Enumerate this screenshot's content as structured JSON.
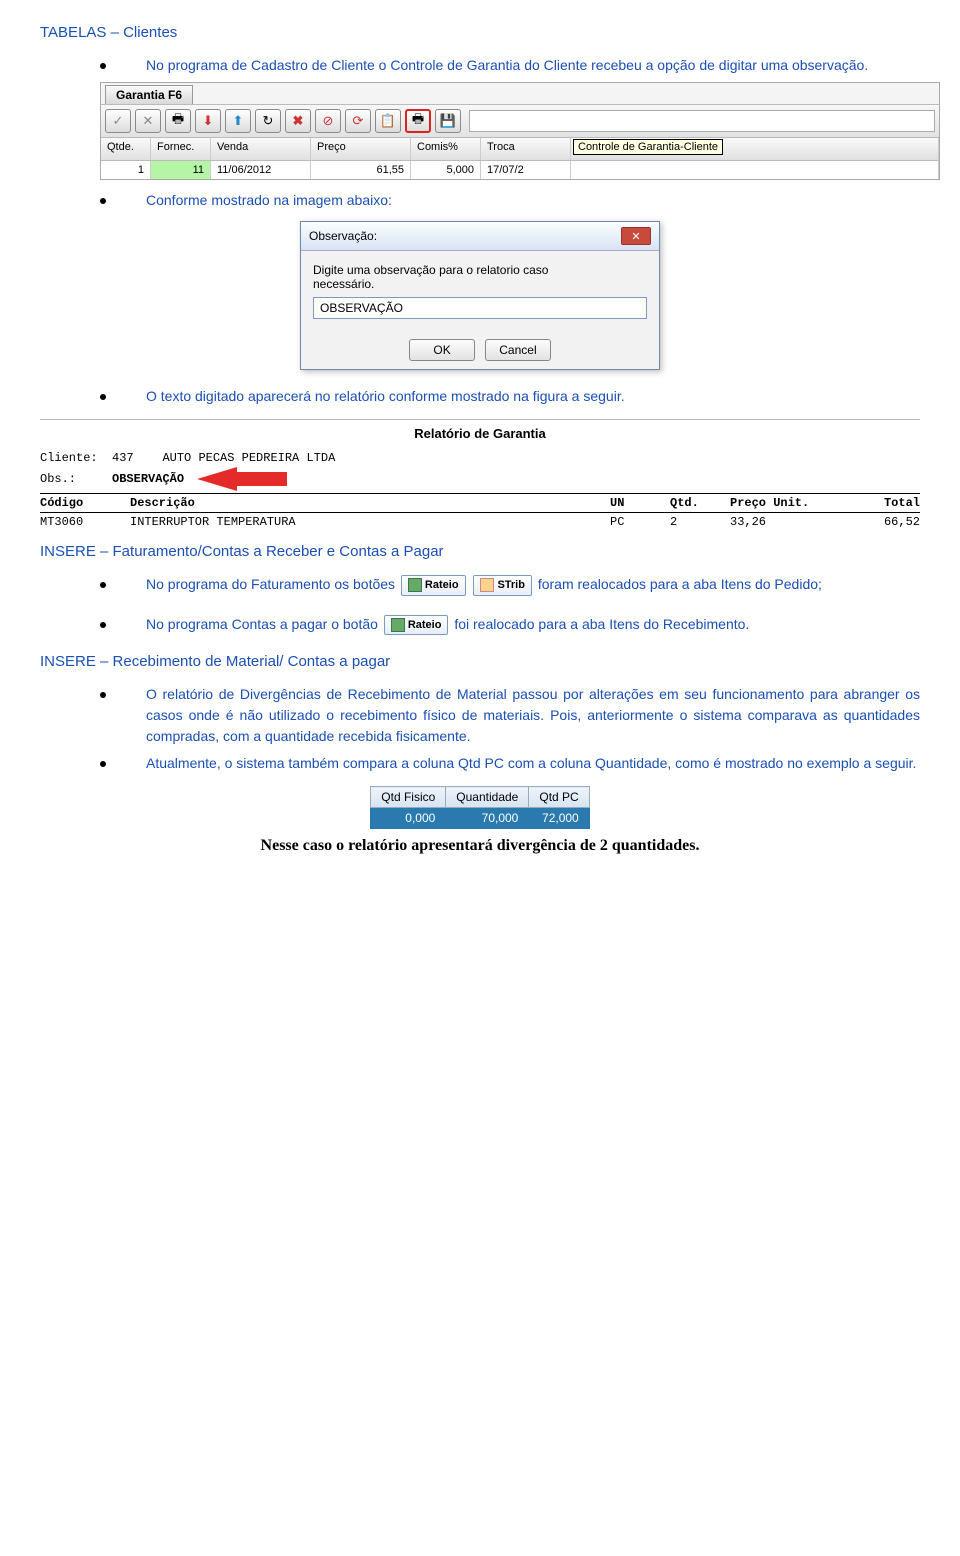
{
  "doc": {
    "h1": "TABELAS – Clientes",
    "b1": "No programa de Cadastro de Cliente o Controle de Garantia do Cliente recebeu a opção de digitar uma observação.",
    "b2": "Conforme mostrado na imagem abaixo:",
    "b3": "O texto digitado aparecerá no relatório conforme mostrado na figura a seguir.",
    "h2": "INSERE – Faturamento/Contas a Receber e Contas a Pagar",
    "b4a": "No programa do Faturamento os botões ",
    "b4b": " foram realocados para a aba Itens do Pedido;",
    "b5a": "No programa Contas a pagar o botão ",
    "b5b": " foi realocado para a aba Itens do Recebimento.",
    "h3": "INSERE – Recebimento de Material/ Contas a pagar",
    "b6": "O relatório de Divergências de Recebimento de Material passou por alterações em seu funcionamento para abranger os casos onde é não utilizado o recebimento físico de materiais. Pois, anteriormente o sistema comparava as quantidades compradas, com a quantidade recebida fisicamente.",
    "b7": "Atualmente, o sistema também compara a coluna Qtd PC com a coluna Quantidade, como é mostrado no exemplo a seguir.",
    "footer": "Nesse caso o relatório apresentará divergência de 2 quantidades."
  },
  "toolbar": {
    "tab": "Garantia F6",
    "tooltip": "Controle de Garantia-Cliente",
    "icons": [
      "confirm-icon",
      "cancel-x-icon",
      "printer-icon",
      "export-down-icon",
      "export-up-icon",
      "refresh-icon",
      "delete-x-icon",
      "forbid-icon",
      "reload-icon",
      "clipboard-icon",
      "print2-icon",
      "save-disk-icon"
    ],
    "glyphs": [
      "✓",
      "✕",
      "🖶",
      "⬇",
      "⬆",
      "↻",
      "✖",
      "⊘",
      "⟳",
      "📋",
      "🖶",
      "💾"
    ],
    "heads": {
      "qtde": "Qtde.",
      "fornec": "Fornec.",
      "venda": "Venda",
      "preco": "Preço",
      "comis": "Comis%",
      "troca": "Troca"
    },
    "row": {
      "qtde": "1",
      "fornec": "11",
      "venda": "11/06/2012",
      "preco": "61,55",
      "comis": "5,000",
      "troca": "17/07/2"
    }
  },
  "dialog": {
    "title": "Observação:",
    "msg1": "Digite uma observação para o relatorio caso",
    "msg2": "necessário.",
    "value": "OBSERVAÇÃO",
    "ok": "OK",
    "cancel": "Cancel"
  },
  "report": {
    "title": "Relatório de Garantia",
    "client_lbl": "Cliente:",
    "client_id": "437",
    "client_name": "AUTO PECAS PEDREIRA LTDA",
    "obs_lbl": "Obs.:",
    "obs_val": "OBSERVAÇÃO",
    "heads": {
      "cod": "Código",
      "desc": "Descrição",
      "un": "UN",
      "qtd": "Qtd.",
      "pu": "Preço Unit.",
      "tot": "Total"
    },
    "row": {
      "cod": "MT3060",
      "desc": "INTERRUPTOR TEMPERATURA",
      "un": "PC",
      "qtd": "2",
      "pu": "33,26",
      "tot": "66,52"
    }
  },
  "buttons": {
    "rateio": "Rateio",
    "strib": "STrib"
  },
  "qty": {
    "h1": "Qtd Fisico",
    "h2": "Quantidade",
    "h3": "Qtd PC",
    "v1": "0,000",
    "v2": "70,000",
    "v3": "72,000"
  }
}
